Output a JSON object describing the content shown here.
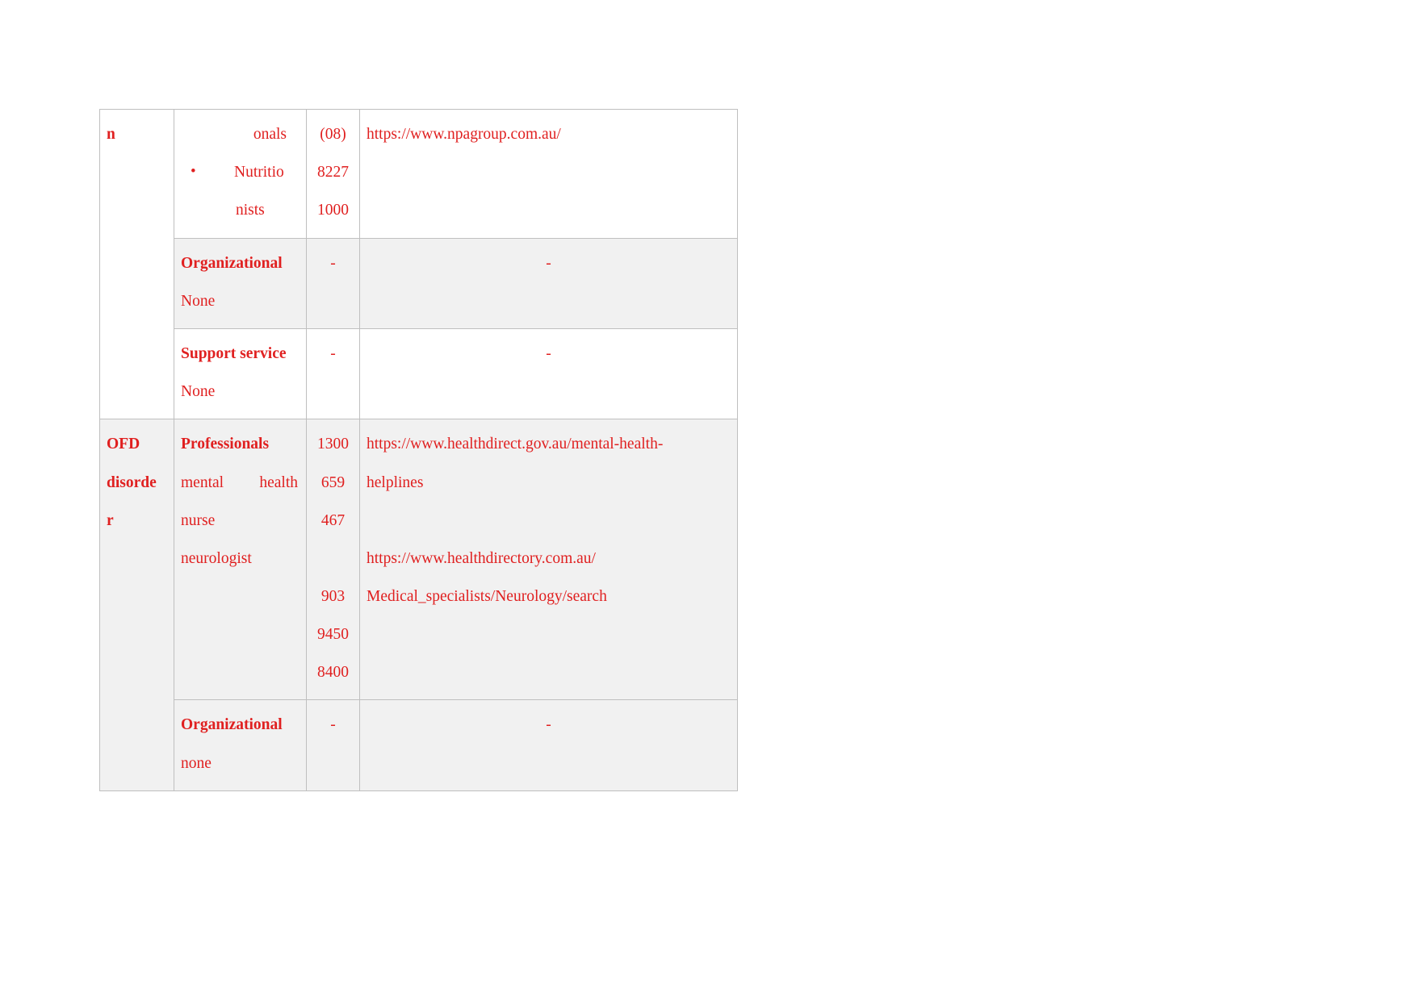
{
  "document": {
    "type": "table",
    "text_color": "#e02020",
    "shade_color": "#f1f1f1",
    "border_color": "#bfbfbf"
  },
  "table": {
    "rows": [
      {
        "id": "row-continuation-professionals",
        "shaded": false,
        "condition": "n",
        "type_lines": [
          "onals",
          "Nutritio",
          "nists"
        ],
        "phone_lines": [
          "(08)",
          "8227",
          "1000"
        ],
        "url_lines": [
          "https://www.npagroup.com.au/"
        ]
      },
      {
        "id": "row-organizational-none-1",
        "shaded": true,
        "condition": "",
        "type_heading": "Organizational",
        "type_value": "None",
        "phone": "-",
        "url": "-"
      },
      {
        "id": "row-support-service-none",
        "shaded": false,
        "condition": "",
        "type_heading": "Support service",
        "type_value": "None",
        "phone": "-",
        "url": "-"
      },
      {
        "id": "row-ofd-professionals",
        "shaded": true,
        "condition_lines": [
          "OFD",
          "disorde",
          "r"
        ],
        "type_heading": "Professionals",
        "type_lines": [
          "mental  health",
          "nurse",
          "neurologist"
        ],
        "phone_lines": [
          "1300",
          "659",
          "467",
          "903",
          "9450",
          "8400"
        ],
        "url_lines": [
          "https://www.healthdirect.gov.au/mental-health-",
          "helplines",
          "https://www.healthdirectory.com.au/",
          "Medical_specialists/Neurology/search"
        ]
      },
      {
        "id": "row-organizational-none-2",
        "shaded": true,
        "condition": "",
        "type_heading": "Organizational",
        "type_value": "none",
        "phone": "-",
        "url": "-"
      }
    ]
  },
  "cells": {
    "r1": {
      "cond": "n",
      "t1": "onals",
      "t2": "Nutritio",
      "t3": "nists",
      "p1": "(08)",
      "p2": "8227",
      "p3": "1000",
      "u1": "https://www.npagroup.com.au/"
    },
    "r2": {
      "head": "Organizational",
      "val": "None",
      "phone": "-",
      "url": "-"
    },
    "r3": {
      "head": "Support service",
      "val": "None",
      "phone": "-",
      "url": "-"
    },
    "r4": {
      "c1": "OFD",
      "c2": "disorde",
      "c3": "r",
      "head": "Professionals",
      "t1a": "mental",
      "t1b": "health",
      "t2": "nurse",
      "t3": "neurologist",
      "p1": "1300",
      "p2": "659",
      "p3": "467",
      "p4": "903",
      "p5": "9450",
      "p6": "8400",
      "u1": "https://www.healthdirect.gov.au/mental-health-",
      "u2": "helplines",
      "u3": "https://www.healthdirectory.com.au/",
      "u4": "Medical_specialists/Neurology/search"
    },
    "r5": {
      "head": "Organizational",
      "val": "none",
      "phone": "-",
      "url": "-"
    }
  }
}
